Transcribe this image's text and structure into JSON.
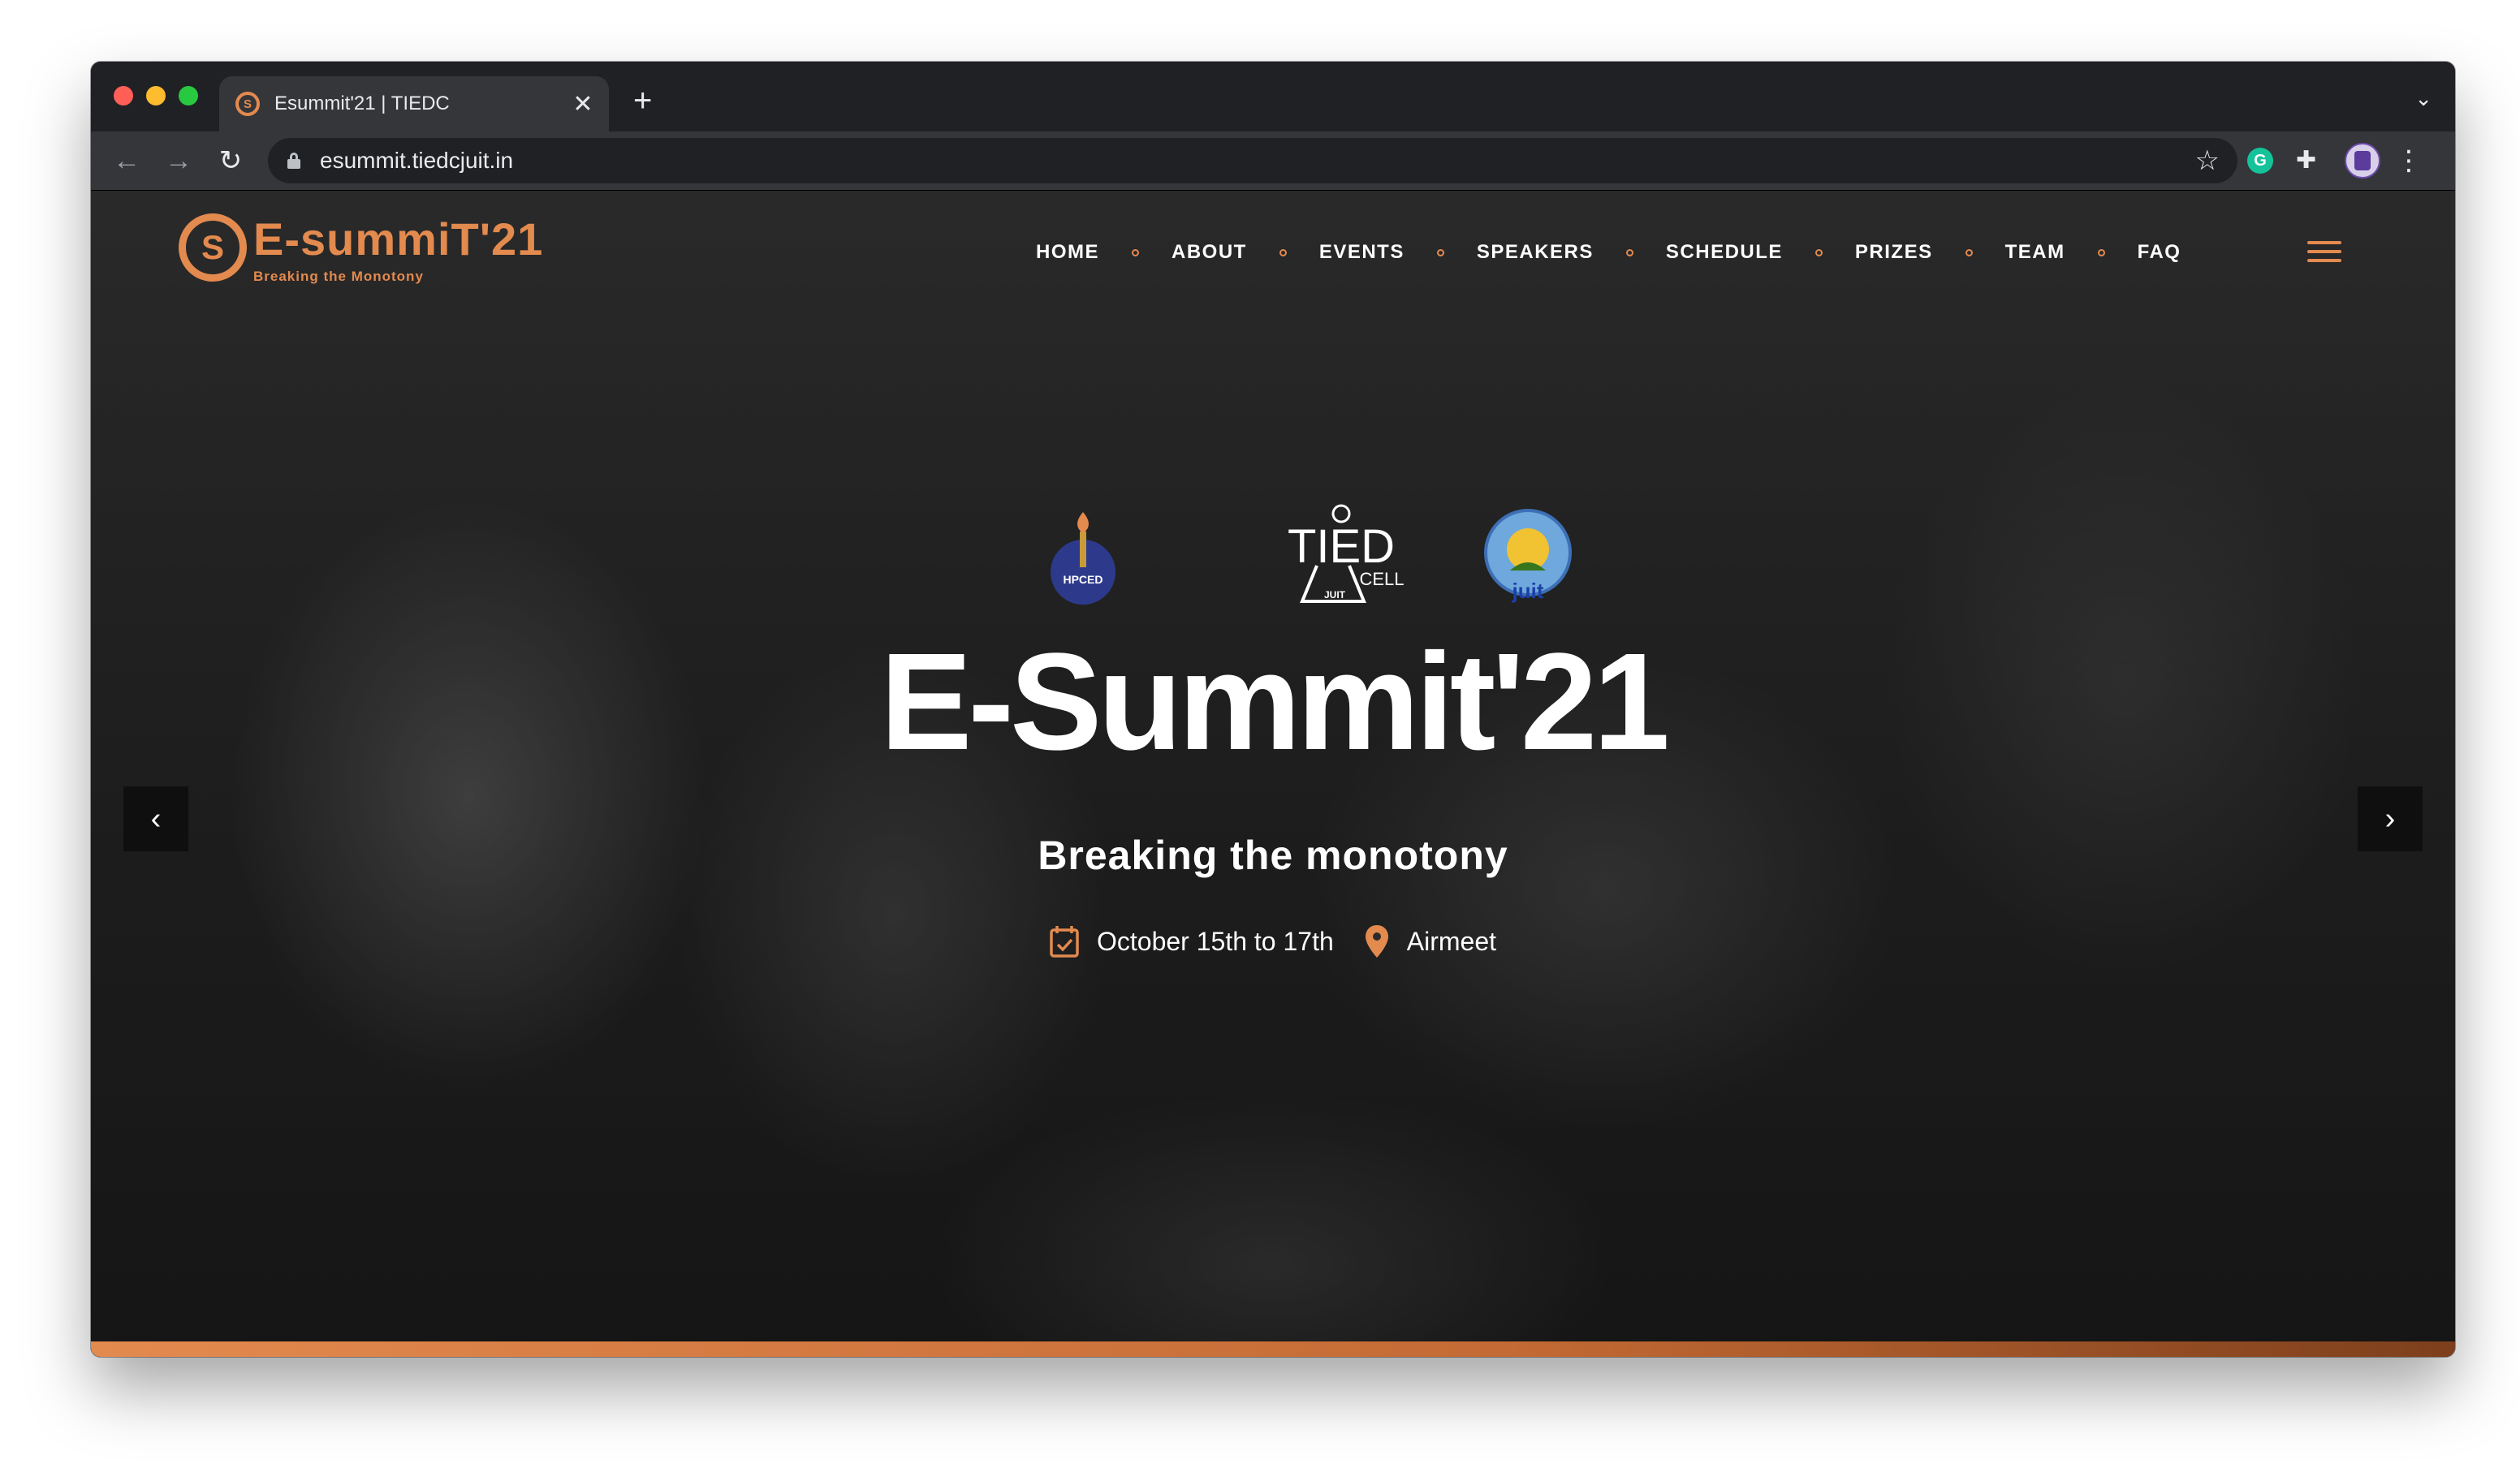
{
  "browser": {
    "tab_title": "Esummit'21 | TIEDC",
    "tab_close": "✕",
    "new_tab": "+",
    "tabs_menu": "⌄",
    "url": "esummit.tiedcjuit.in",
    "back": "←",
    "forward": "→",
    "reload": "↻",
    "bookmark": "☆",
    "extension_g": "G",
    "extensions": "✚",
    "menu": "⋮"
  },
  "site": {
    "logo_mark": "S",
    "logo_text": "E-summiT'21",
    "logo_sub": "Breaking the Monotony",
    "nav": [
      "HOME",
      "ABOUT",
      "EVENTS",
      "SPEAKERS",
      "SCHEDULE",
      "PRIZES",
      "TEAM",
      "FAQ"
    ]
  },
  "hero": {
    "title": "E-Summit'21",
    "subtitle": "Breaking the monotony",
    "date": "October 15th to 17th",
    "venue": "Airmeet",
    "prev": "‹",
    "next": "›",
    "partner_logos": [
      {
        "name": "HPCED",
        "label": "HPCED"
      },
      {
        "name": "TIEDC Cell",
        "label": "TIED",
        "sub": "CELL",
        "badge": "JUIT"
      },
      {
        "name": "JUIT",
        "label": "juit"
      }
    ]
  },
  "colors": {
    "accent": "#e38a4f",
    "tab_bar": "#202124",
    "toolbar": "#35363a"
  }
}
